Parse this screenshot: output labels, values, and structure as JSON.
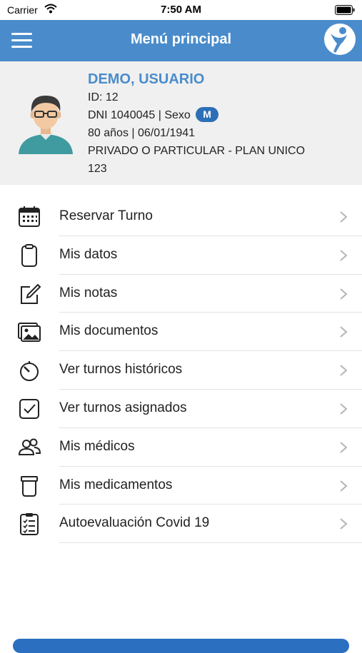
{
  "status_bar": {
    "carrier": "Carrier",
    "time": "7:50 AM"
  },
  "header": {
    "title": "Menú principal"
  },
  "profile": {
    "name": "DEMO, USUARIO",
    "id_line": "ID: 12",
    "dni_line": "DNI 1040045 | Sexo",
    "sex": "M",
    "age_line": "80 años | 06/01/1941",
    "plan_line": "PRIVADO O PARTICULAR - PLAN UNICO",
    "plan_number": "123"
  },
  "menu": {
    "items": [
      {
        "label": "Reservar Turno",
        "icon": "calendar-icon"
      },
      {
        "label": "Mis datos",
        "icon": "clipboard-icon"
      },
      {
        "label": "Mis notas",
        "icon": "edit-note-icon"
      },
      {
        "label": "Mis documentos",
        "icon": "image-gallery-icon"
      },
      {
        "label": "Ver turnos históricos",
        "icon": "timer-icon"
      },
      {
        "label": "Ver turnos asignados",
        "icon": "checkbox-icon"
      },
      {
        "label": "Mis médicos",
        "icon": "people-icon"
      },
      {
        "label": "Mis medicamentos",
        "icon": "medicine-jar-icon"
      },
      {
        "label": "Autoevaluación Covid 19",
        "icon": "checklist-icon"
      }
    ]
  },
  "colors": {
    "header": "#4a8ccb",
    "name": "#4a8ccb",
    "badge": "#2d6fb6",
    "profile_bg": "#f0f0f0"
  }
}
